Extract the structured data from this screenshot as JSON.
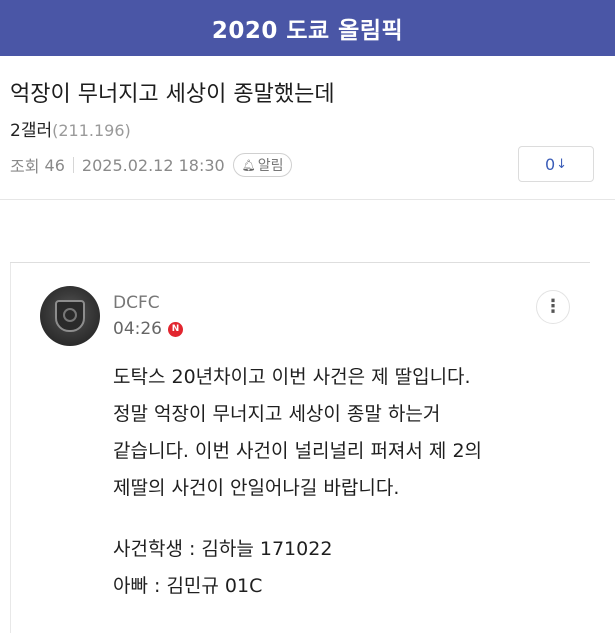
{
  "header": {
    "title": "2020 도쿄 올림픽"
  },
  "post": {
    "title": "억장이 무너지고 세상이 종말했는데",
    "author": "2갤러",
    "author_ip": "(211.196)",
    "views_label": "조회",
    "views": "46",
    "datetime": "2025.02.12 18:30",
    "alarm_label": "알림",
    "comment_count": "0"
  },
  "comment": {
    "author": "DCFC",
    "time": "04:26",
    "new_badge": "N",
    "lines": [
      "도탁스 20년차이고 이번 사건은 제 딸입니다.",
      "정말 억장이 무너지고 세상이 종말 하는거",
      "같습니다. 이번 사건이 널리널리 퍼져서 제 2의",
      "제딸의 사건이 안일어나길 바랍니다.",
      "",
      "사건학생 : 김하늘 171022",
      "아빠 : 김민규 01C"
    ]
  },
  "icons": {
    "bell": "bell-icon",
    "down_arrow": "down-arrow-icon",
    "more": "more-vertical-icon"
  },
  "colors": {
    "header_bg": "#4a56a6",
    "accent_blue": "#3b5db8",
    "new_badge": "#e2262f"
  }
}
